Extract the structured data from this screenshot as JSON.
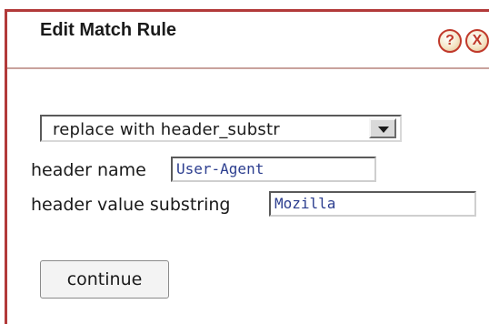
{
  "dialog": {
    "title": "Edit Match Rule",
    "help_icon": "help-icon",
    "close_icon": "close-icon",
    "help_glyph": "?",
    "close_glyph": "X"
  },
  "form": {
    "rule_type_select": {
      "selected": "replace with header_substr"
    },
    "header_name": {
      "label": "header name",
      "value": "User-Agent"
    },
    "header_value_substring": {
      "label": "header value substring",
      "value": "Mozilla"
    },
    "continue_label": "continue"
  },
  "colors": {
    "border_accent": "#b23a3a",
    "input_text": "#2c3e8f"
  }
}
